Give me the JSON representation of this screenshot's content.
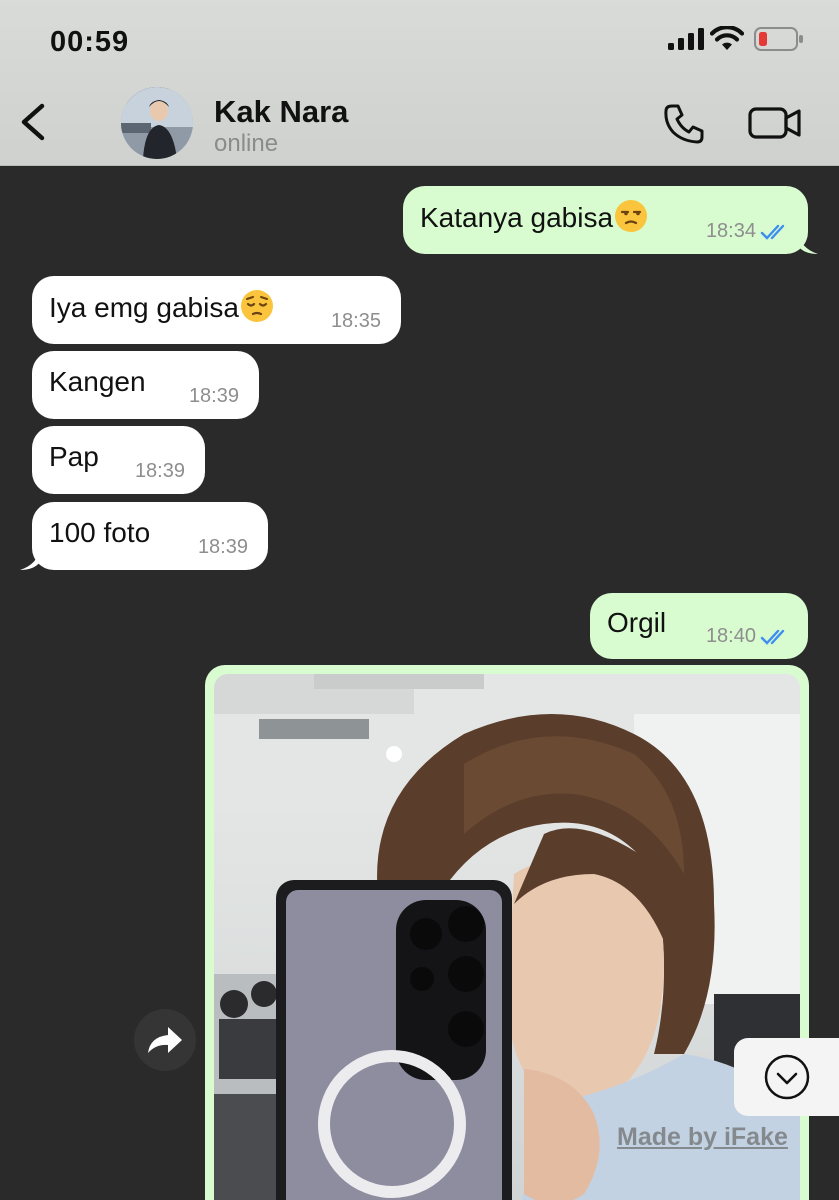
{
  "status_bar": {
    "time": "00:59"
  },
  "header": {
    "contact_name": "Kak Nara",
    "contact_status": "online",
    "icons": [
      "back-chevron-icon",
      "avatar",
      "phone-icon",
      "video-camera-icon"
    ]
  },
  "messages": [
    {
      "direction": "outgoing",
      "text": "Katanya gabisa",
      "emoji": "unamused-face",
      "time": "18:34",
      "read": true
    },
    {
      "direction": "incoming",
      "text": "Iya emg gabisa",
      "emoji": "pensive-face",
      "time": "18:35"
    },
    {
      "direction": "incoming",
      "text": "Kangen",
      "time": "18:39"
    },
    {
      "direction": "incoming",
      "text": "Pap",
      "time": "18:39"
    },
    {
      "direction": "incoming",
      "text": "100 foto",
      "time": "18:39"
    },
    {
      "direction": "outgoing",
      "text": "Orgil",
      "time": "18:40",
      "read": true
    },
    {
      "direction": "outgoing",
      "type": "image"
    }
  ],
  "controls": {
    "forward_icon": "forward-arrow-icon",
    "scroll_down_icon": "chevron-down-circle-icon"
  },
  "watermark": "Made by iFake",
  "colors": {
    "chat_background": "#2a2a2a",
    "outgoing_bubble": "#d8fbd0",
    "incoming_bubble": "#ffffff",
    "read_ticks": "#3d8ef0",
    "header_background": "#d5d7d5",
    "battery_low": "#e53935"
  }
}
